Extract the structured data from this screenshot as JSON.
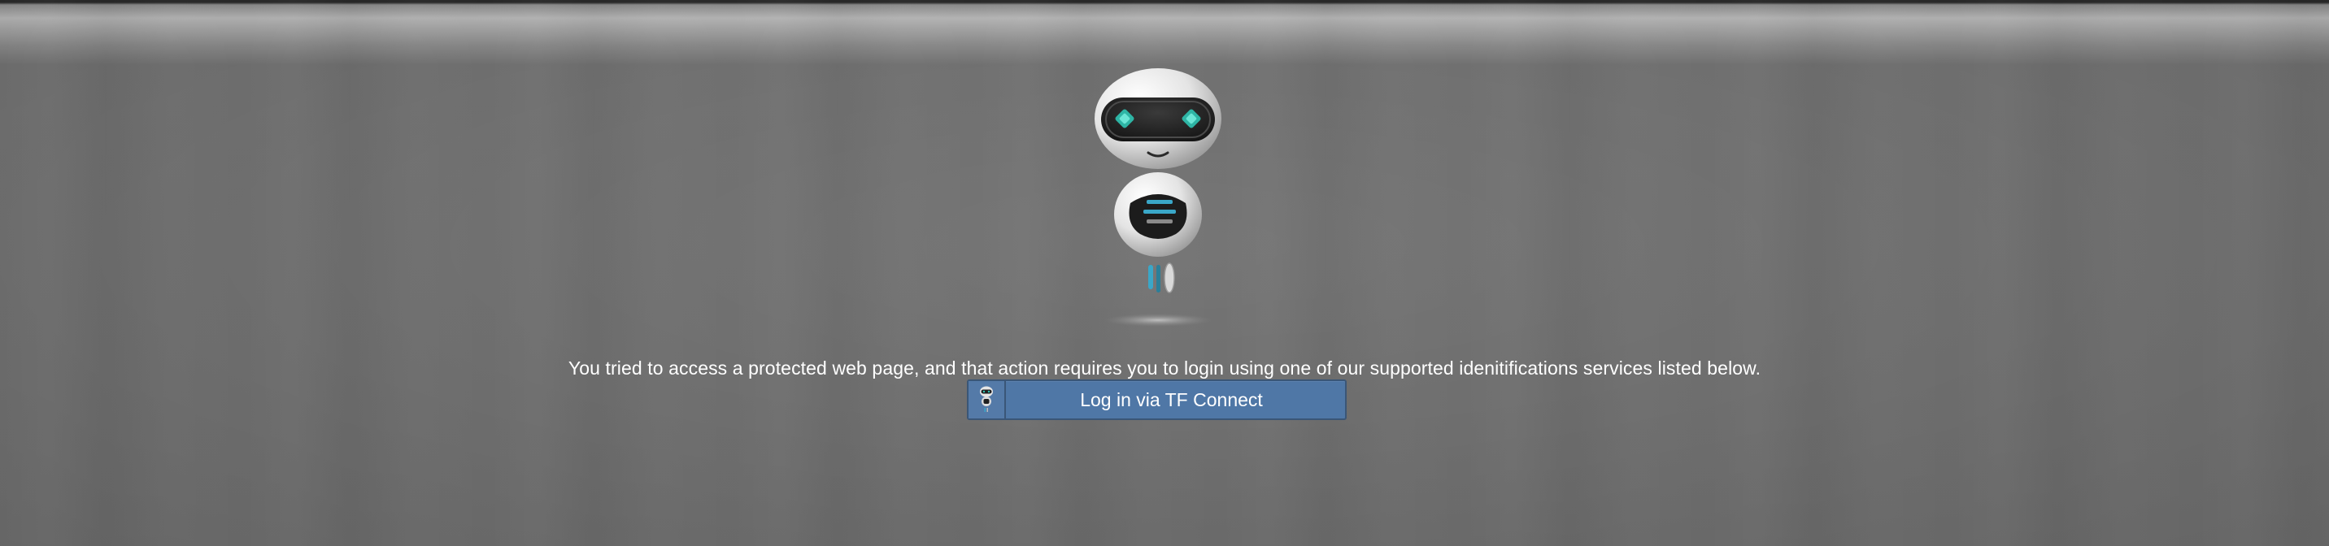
{
  "page": {
    "message": "You tried to access a protected web page, and that action requires you to login using one of our supported idenitifications services listed below."
  },
  "login": {
    "button_label": "Log in via TF Connect",
    "icon": "robot-icon"
  },
  "mascot": {
    "icon": "robot-mascot",
    "eye_color": "#2fc4b2",
    "accent_color": "#3aa7c8"
  },
  "colors": {
    "button_bg": "#4f77a6",
    "button_border": "#3a5677",
    "background": "#6e6e6e"
  }
}
